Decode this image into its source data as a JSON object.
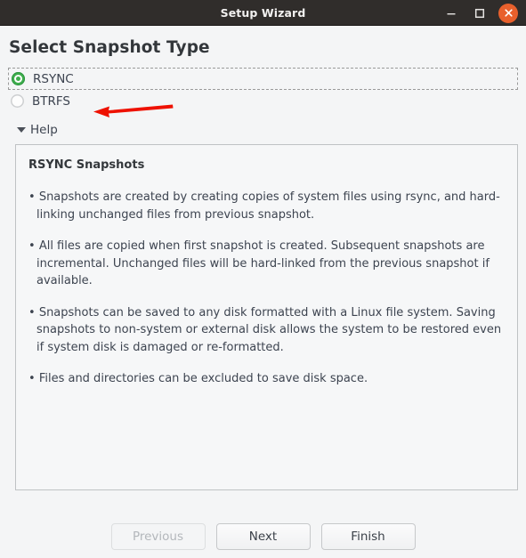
{
  "window": {
    "title": "Setup Wizard",
    "controls": {
      "minimize": "minimize-icon",
      "maximize": "maximize-icon",
      "close": "close-icon"
    },
    "accent_close_color": "#e8602c",
    "titlebar_color": "#302d2b"
  },
  "page": {
    "title": "Select Snapshot Type"
  },
  "snapshot_type": {
    "selected": "RSYNC",
    "options": [
      {
        "label": "RSYNC",
        "selected": true,
        "focused": true
      },
      {
        "label": "BTRFS",
        "selected": false,
        "focused": false
      }
    ],
    "selected_color": "#3fae4d"
  },
  "annotation": {
    "arrow_color": "#ee1100",
    "points_to": "RSYNC",
    "direction": "left"
  },
  "help": {
    "expander_label": "Help",
    "expanded": true,
    "heading": "RSYNC Snapshots",
    "bullets": [
      "Snapshots are created by creating copies of system files using rsync, and hard-linking unchanged files from previous snapshot.",
      "All files are copied when first snapshot is created. Subsequent snapshots are incremental. Unchanged files will be hard-linked from the previous snapshot if available.",
      "Snapshots can be saved to any disk formatted with a Linux file system. Saving snapshots to non-system or external disk allows the system to be restored even if system disk is damaged or re-formatted.",
      "Files and directories can be excluded to save disk space."
    ]
  },
  "footer": {
    "previous_label": "Previous",
    "next_label": "Next",
    "finish_label": "Finish",
    "previous_disabled": true
  }
}
